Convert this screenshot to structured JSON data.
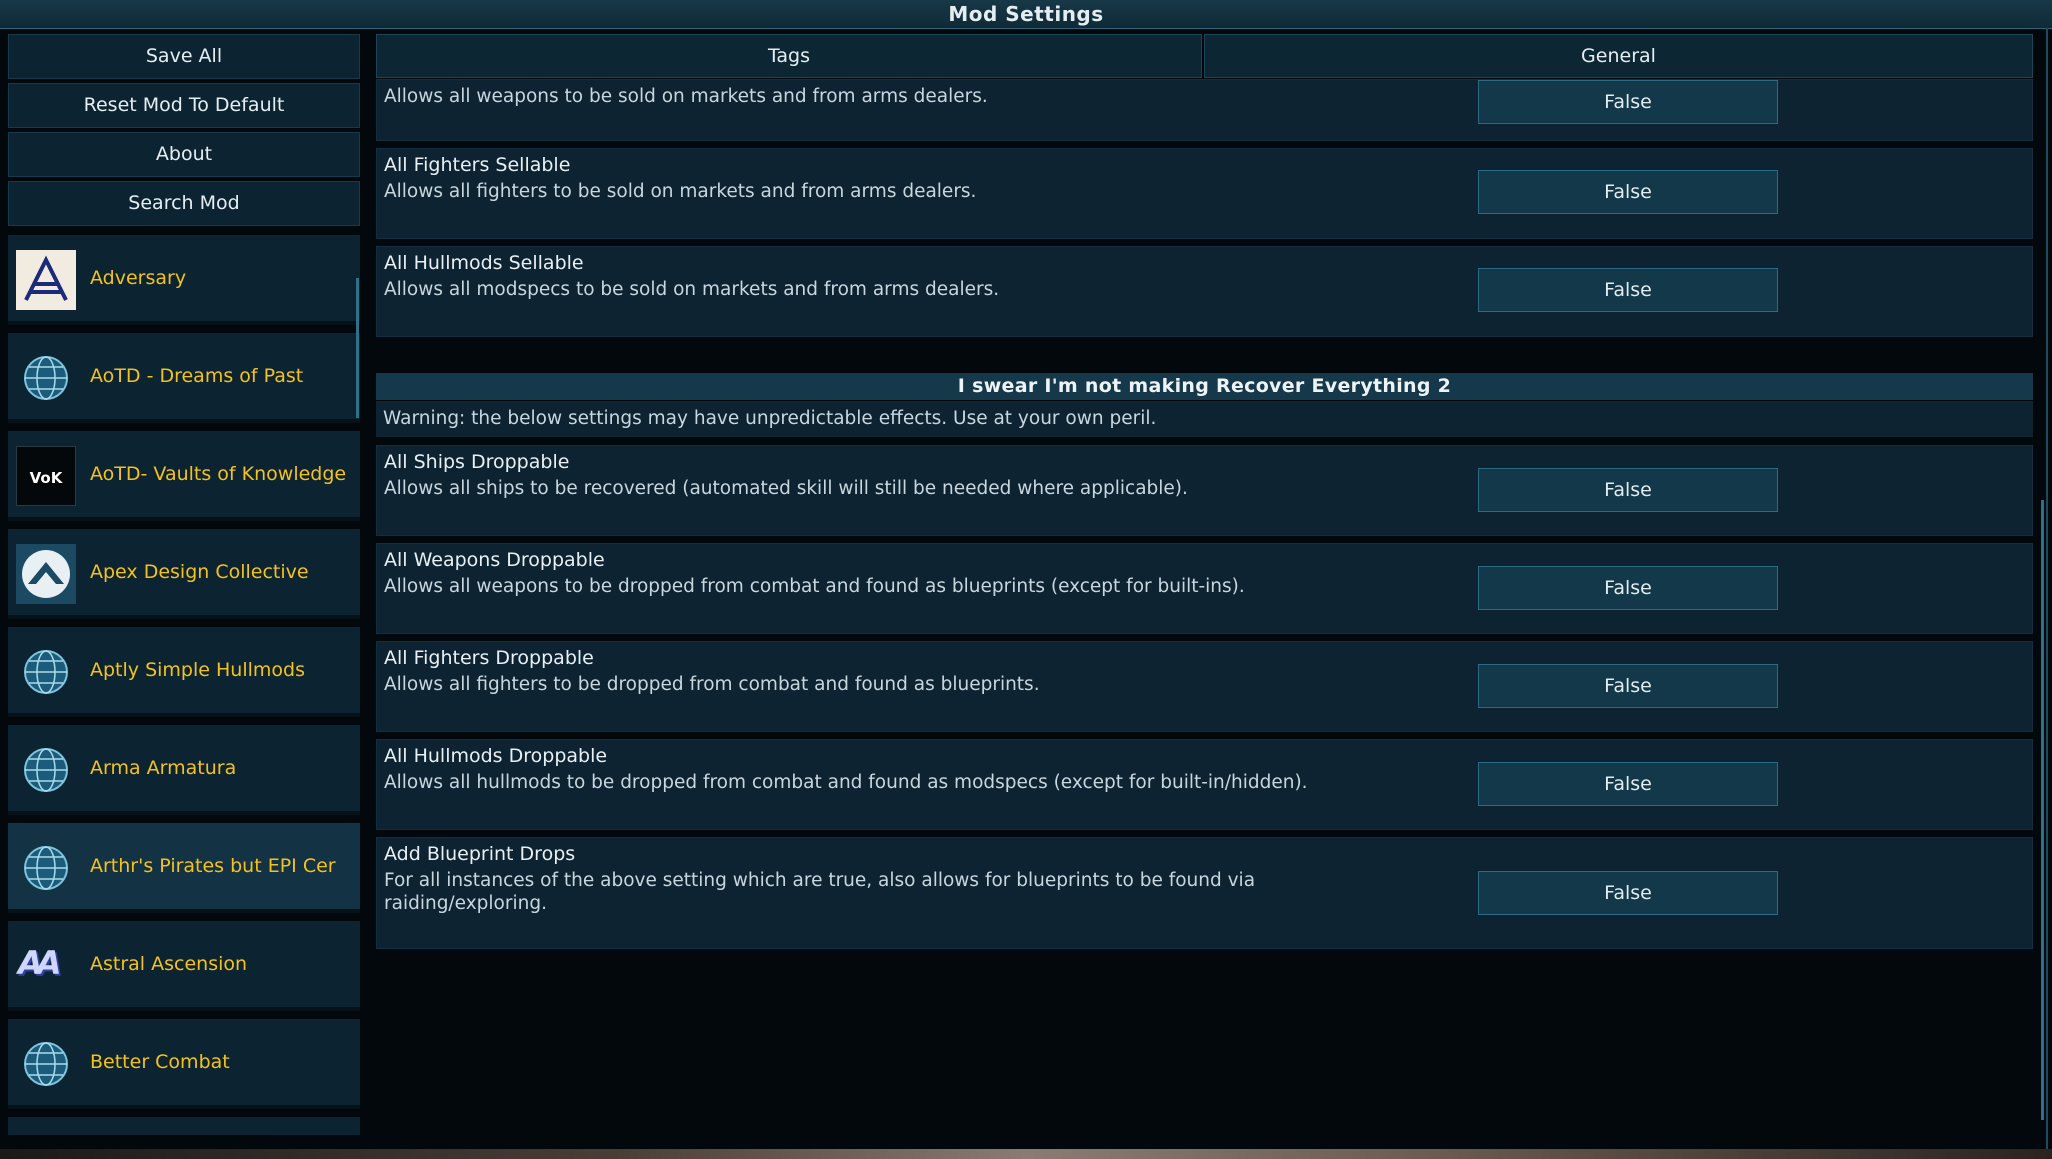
{
  "window": {
    "title": "Mod Settings"
  },
  "menu": {
    "save_all": "Save All",
    "reset": "Reset Mod To Default",
    "about": "About",
    "search": "Search Mod"
  },
  "tabs": [
    {
      "label": "Tags"
    },
    {
      "label": "General"
    }
  ],
  "mods": [
    {
      "name": "Adversary",
      "icon": "adversary-logo-icon"
    },
    {
      "name": "AoTD - Dreams of Past",
      "icon": "globe-icon"
    },
    {
      "name": "AoTD- Vaults of Knowledge",
      "icon": "vok-logo-icon",
      "icon_text": "VoK"
    },
    {
      "name": "Apex Design Collective",
      "icon": "apex-logo-icon"
    },
    {
      "name": "Aptly Simple Hullmods",
      "icon": "globe-icon"
    },
    {
      "name": "Arma Armatura",
      "icon": "globe-icon"
    },
    {
      "name": "Arthr's Pirates but EPI Cer",
      "icon": "globe-icon",
      "selected": true
    },
    {
      "name": "Astral Ascension",
      "icon": "astral-logo-icon",
      "icon_text": "AA"
    },
    {
      "name": "Better Combat",
      "icon": "globe-icon"
    }
  ],
  "settings_top": [
    {
      "title": "",
      "desc": "Allows all weapons to be sold on markets and from arms dealers.",
      "value": "False"
    },
    {
      "title": "All Fighters Sellable",
      "desc": "Allows all fighters to be sold on markets and from arms dealers.",
      "value": "False"
    },
    {
      "title": "All Hullmods Sellable",
      "desc": "Allows all modspecs to be sold on markets and from arms dealers.",
      "value": "False"
    }
  ],
  "section": {
    "header": "I swear I'm not making Recover Everything 2",
    "warning": "Warning: the below settings may have unpredictable effects. Use at your own peril."
  },
  "settings_section": [
    {
      "title": "All Ships Droppable",
      "desc": "Allows all ships to be recovered (automated skill will still be needed where applicable).",
      "value": "False"
    },
    {
      "title": "All Weapons Droppable",
      "desc": "Allows all weapons to be dropped from combat and found as blueprints (except for built-ins).",
      "value": "False"
    },
    {
      "title": "All Fighters Droppable",
      "desc": "Allows all fighters to be dropped from combat and found as blueprints.",
      "value": "False"
    },
    {
      "title": "All Hullmods Droppable",
      "desc": "Allows all hullmods to be dropped from combat and found as modspecs (except for built-in/hidden).",
      "value": "False"
    },
    {
      "title": "Add Blueprint Drops",
      "desc": "For all instances of the above setting which are true, also allows for blueprints to be found via raiding/exploring.",
      "value": "False"
    }
  ],
  "colors": {
    "accent": "#f4c21e",
    "panel": "#0d2331",
    "border": "#2a6a82"
  }
}
